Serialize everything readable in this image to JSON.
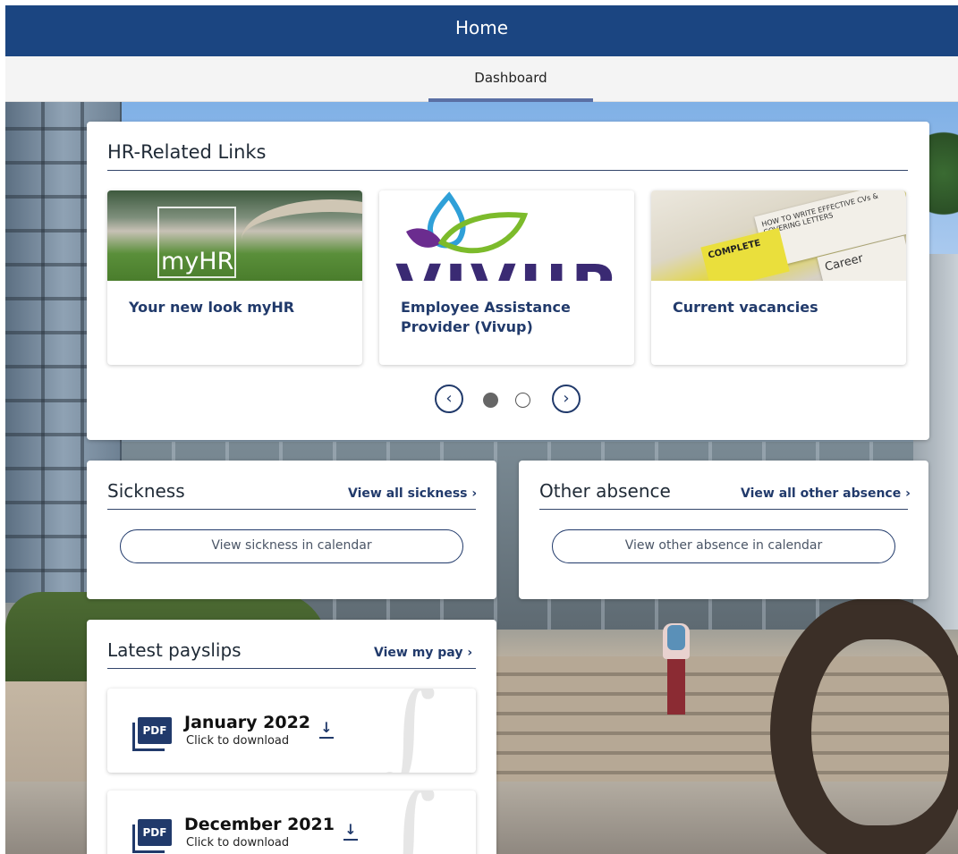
{
  "header": {
    "title": "Home"
  },
  "subnav": {
    "tab_dashboard": "Dashboard"
  },
  "hr_links": {
    "title": "HR-Related Links",
    "tiles": [
      {
        "label": "Your new look myHR",
        "image_text": "myHR"
      },
      {
        "label": "Employee Assistance Provider (Vivup)",
        "image_text": "VIVUP"
      },
      {
        "label": "Current vacancies",
        "image_text_1": "HOW TO WRITE EFFECTIVE CVs & COVERING LETTERS",
        "image_text_2": "COMPLETE",
        "image_text_3": "Career"
      }
    ],
    "carousel": {
      "active_page": 1,
      "page_count": 2,
      "prev_icon": "chevron-left-icon",
      "next_icon": "chevron-right-icon"
    }
  },
  "sickness": {
    "title": "Sickness",
    "view_all": "View all sickness ›",
    "calendar_button": "View sickness in calendar"
  },
  "other_absence": {
    "title": "Other absence",
    "view_all": "View all other absence ›",
    "calendar_button": "View other absence in calendar"
  },
  "payslips": {
    "title": "Latest payslips",
    "view_all": "View my pay ›",
    "items": [
      {
        "month": "January 2022",
        "sub": "Click to download",
        "icon_text": "PDF"
      },
      {
        "month": "December 2021",
        "sub": "Click to download",
        "icon_text": "PDF"
      }
    ]
  },
  "colors": {
    "brand": "#1b4581",
    "accent": "#213a6b",
    "tab_indicator": "#5a6fa4"
  }
}
